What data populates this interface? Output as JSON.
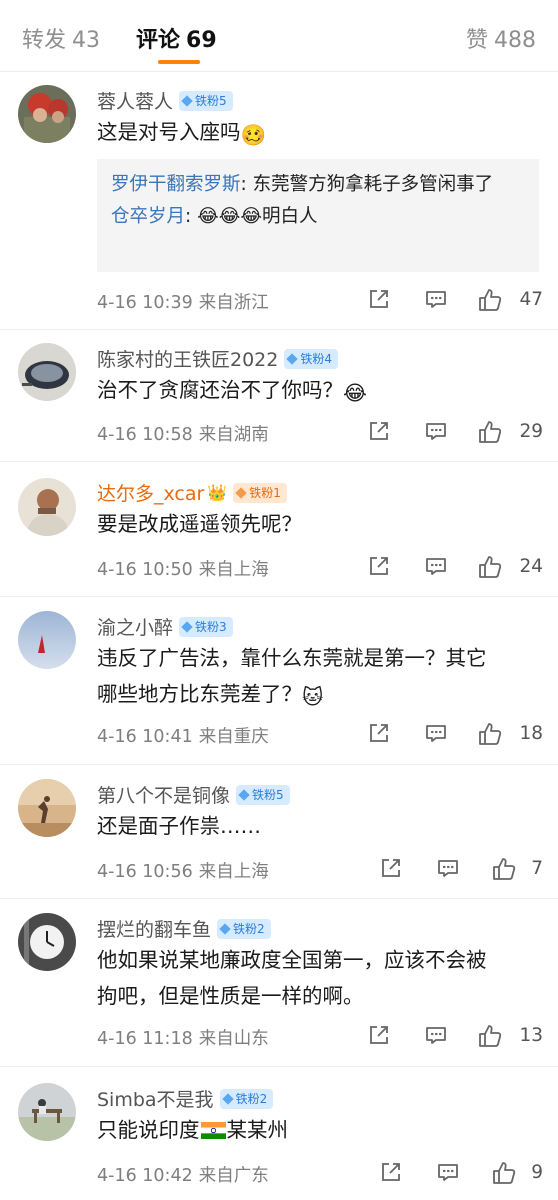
{
  "tabs": {
    "repost_label": "转发",
    "repost_count": "43",
    "comment_label": "评论",
    "comment_count": "69",
    "like_label": "赞",
    "like_count": "488",
    "accent": "#ff8200"
  },
  "comments": [
    {
      "username": "蓉人蓉人",
      "badge": "铁粉5",
      "text": "这是对号入座吗",
      "emoji": "🥴",
      "replies": [
        {
          "user": "罗伊干翻索罗斯",
          "sep": ": ",
          "text": "东莞警方狗拿耗子多管闲事了"
        },
        {
          "user": "仓卒岁月",
          "sep": ": ",
          "text": "😂😂😂明白人"
        }
      ],
      "time": "4-16 10:39",
      "location": "来自浙江",
      "likes": "47"
    },
    {
      "username": "陈家村的王铁匠2022",
      "badge": "铁粉4",
      "text": "治不了贪腐还治不了你吗？",
      "emoji": "😂",
      "time": "4-16 10:58",
      "location": "来自湖南",
      "likes": "29"
    },
    {
      "username": "达尔多_xcar",
      "badge": "铁粉1",
      "crown": "👑",
      "text": "要是改成遥遥领先呢？",
      "time": "4-16 10:50",
      "location": "来自上海",
      "likes": "24"
    },
    {
      "username": "渝之小醉",
      "badge": "铁粉3",
      "text_line1": "违反了广告法，靠什么东莞就是第一？其它",
      "text_line2": "哪些地方比东莞差了？",
      "emoji": "🐱",
      "time": "4-16 10:41",
      "location": "来自重庆",
      "likes": "18"
    },
    {
      "username": "第八个不是铜像",
      "badge": "铁粉5",
      "text": "还是面子作祟……",
      "time": "4-16 10:56",
      "location": "来自上海",
      "likes": "7"
    },
    {
      "username": "摆烂的翻车鱼",
      "badge": "铁粉2",
      "text_line1": "他如果说某地廉政度全国第一，应该不会被",
      "text_line2": "拘吧，但是性质是一样的啊。",
      "time": "4-16 11:18",
      "location": "来自山东",
      "likes": "13"
    },
    {
      "username": "Simba不是我",
      "badge": "铁粉2",
      "text_before": "只能说印度",
      "flag": "🇮🇳",
      "text_after": "某某州",
      "time": "4-16 10:42",
      "location": "来自广东",
      "likes": "9"
    }
  ],
  "icons": {
    "share": "share-icon",
    "reply": "comment-icon",
    "like": "thumbs-up-icon",
    "badge": "diamond-icon"
  }
}
